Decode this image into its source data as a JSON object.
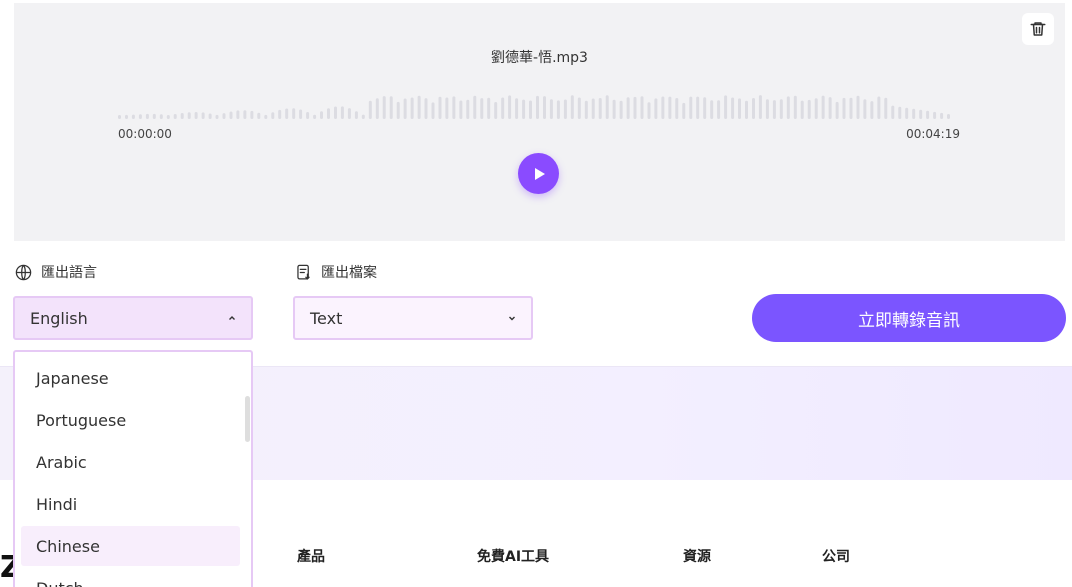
{
  "audio": {
    "file_name": "劉德華-悟.mp3",
    "time_start": "00:00:00",
    "time_end": "00:04:19"
  },
  "options": {
    "language_label": "匯出語言",
    "file_label": "匯出檔案",
    "language_selected": "English",
    "file_selected": "Text",
    "transcribe_button": "立即轉錄音訊"
  },
  "dropdown": {
    "items": [
      "Japanese",
      "Portuguese",
      "Arabic",
      "Hindi",
      "Chinese",
      "Dutch"
    ],
    "highlighted": "Chinese"
  },
  "footer": {
    "logo_letter": "Z",
    "columns": [
      "產品",
      "免費AI工具",
      "資源",
      "公司"
    ]
  },
  "colors": {
    "accent": "#8a4bff",
    "button": "#7b55ff",
    "select_border": "#e6c9f5"
  }
}
